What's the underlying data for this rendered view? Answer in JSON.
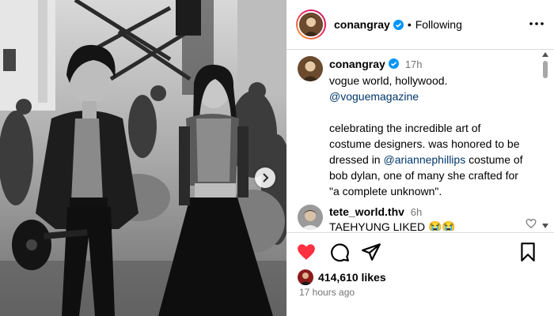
{
  "post": {
    "username": "conangray",
    "following_label": "Following",
    "dot": "•",
    "more_icon": "more-horizontal-icon",
    "posted_ago": "17 hours ago",
    "likes": "414,610 likes"
  },
  "caption": {
    "username": "conangray",
    "time": "17h",
    "line1": "vogue world, hollywood.",
    "mention1": "@voguemagazine",
    "line2": "celebrating the incredible art of",
    "line3": "costume designers. was honored to be",
    "line4_pre": "dressed in ",
    "mention2": "@ariannephillips",
    "line4_post": " costume of",
    "line5": "bob dylan, one of many she crafted for",
    "line6": "\"a complete unknown\"."
  },
  "comment": {
    "username": "tete_world.thv",
    "time": "6h",
    "text": "TAEHYUNG LIKED 😭😭"
  },
  "actions": {
    "like_icon": "heart-filled-icon",
    "comment_icon": "comment-icon",
    "share_icon": "send-icon",
    "save_icon": "bookmark-icon"
  },
  "colors": {
    "like_red": "#ff3040",
    "verified_blue": "#0095f6",
    "mention_blue": "#00376b",
    "muted_gray": "#737373"
  }
}
